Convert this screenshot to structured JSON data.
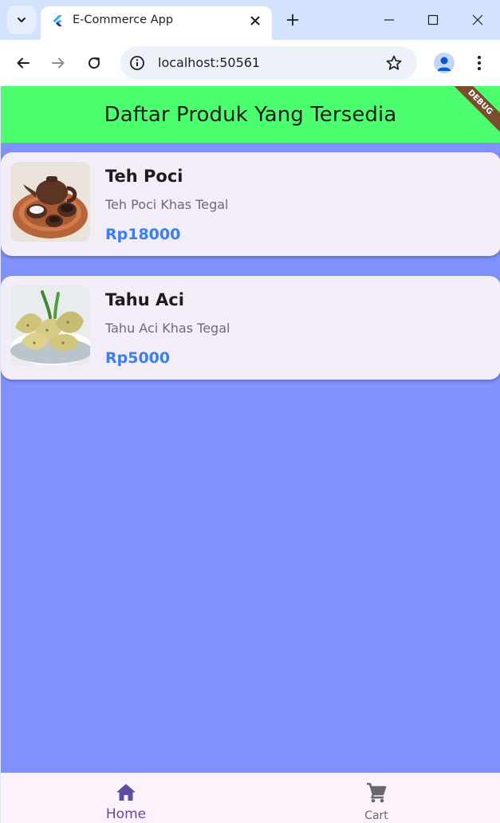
{
  "browser": {
    "tab_title": "E-Commerce App",
    "url": "localhost:50561"
  },
  "app": {
    "title": "Daftar Produk Yang Tersedia",
    "debug_banner": "DEBUG",
    "background_color": "#8192ff",
    "appbar_color": "#4cff6e",
    "products": [
      {
        "name": "Teh Poci",
        "description": "Teh Poci Khas Tegal",
        "price": "Rp18000",
        "image_icon": "teapot-photo"
      },
      {
        "name": "Tahu Aci",
        "description": "Tahu Aci Khas Tegal",
        "price": "Rp5000",
        "image_icon": "fried-tofu-photo"
      }
    ],
    "nav": {
      "home_label": "Home",
      "cart_label": "Cart",
      "active": "Home"
    }
  }
}
